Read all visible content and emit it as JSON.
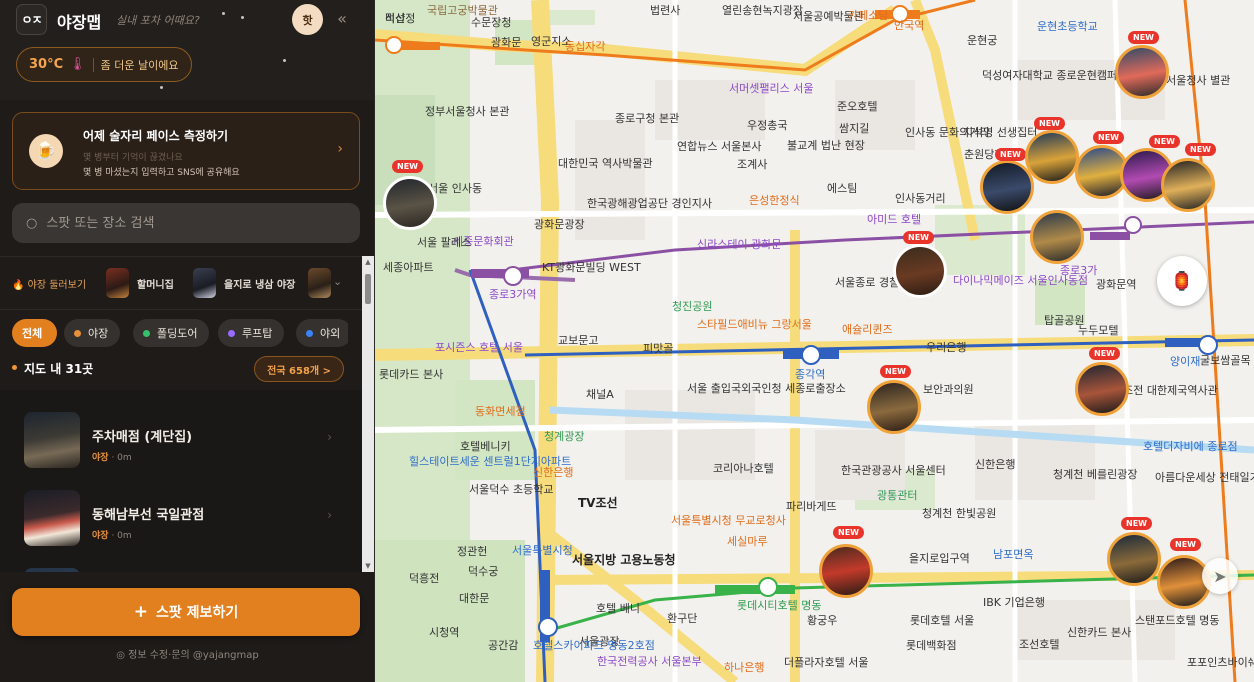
{
  "header": {
    "logo_text": "ㅇㅈ",
    "app_title": "야장맵",
    "tagline": "실내 포차 어때요?",
    "night_toggle_label": "핫"
  },
  "weather": {
    "temperature": "30°C",
    "message": "좀 더운 날이에요"
  },
  "promo": {
    "title": "어제 술자리 페이스 측정하기",
    "line1": "몇 병부터 기억이 끊겼나요",
    "line2": "몇 병 마셨는지 입력하고 SNS에 공유해요"
  },
  "search": {
    "placeholder": "스팟 또는 장소 검색"
  },
  "tour": {
    "label": "야장 둘러보기",
    "items": [
      {
        "label": "할머니집"
      },
      {
        "label": "을지로 냉삼 야장"
      }
    ]
  },
  "filters": [
    {
      "label": "전체",
      "color": "#e27f1e"
    },
    {
      "label": "야장",
      "color": "#e8913b"
    },
    {
      "label": "폴딩도어",
      "color": "#36c06b"
    },
    {
      "label": "루프탑",
      "color": "#9a6bff"
    },
    {
      "label": "야외",
      "color": "#3a82f6"
    }
  ],
  "results": {
    "count_label": "지도 내 31곳",
    "nation_button": "전국 658개 >"
  },
  "spots": [
    {
      "name": "주차매점 (계단집)",
      "category": "야장",
      "distance": "· 0m"
    },
    {
      "name": "동해남부선 국일관점",
      "category": "야장",
      "distance": "· 0m"
    }
  ],
  "report_button": {
    "icon": "+",
    "label": "스팟 제보하기"
  },
  "footer": {
    "text": "정보 수정·문의 @yajangmap"
  },
  "map": {
    "labels": [
      "국립고궁박물관",
      "수문장청",
      "광화문",
      "영군지소",
      "동십자각",
      "법련사",
      "열린송현녹지광장",
      "서울공예박물관",
      "카페소담",
      "안국역",
      "운현궁",
      "운현초등학교",
      "덕성여자대학교 종로운현캠퍼스",
      "정부서울청사 본관",
      "종로구청 본관",
      "서머셋팰리스 서울",
      "우정총국",
      "준오호텔",
      "쌈지길",
      "인사동 문화의거리",
      "지석영 선생집터",
      "대한민국 역사박물관",
      "연합뉴스 서울본사",
      "조계사",
      "불교계 법난 현장",
      "광화문광장",
      "한국광해광업공단 경인지사",
      "은성한정식",
      "에스팀",
      "인사동거리",
      "세종문화회관",
      "신라스테이 광화문",
      "아미드 호텔",
      "다이나믹메이즈 서울인사동점",
      "탑골공원",
      "누두모텔",
      "세종아파트",
      "KT광화문빌딩 WEST",
      "서울종로 경찰서",
      "청진공원",
      "스타필드애비뉴 그랑서울",
      "애슐리퀸즈",
      "우리은행",
      "포시즌스 호텔 서울",
      "교보문고",
      "피맛골",
      "서울 출입국외국인청 세종로출장소",
      "종각역",
      "보안과의원",
      "채널A",
      "롯데카드 본사",
      "동화면세점",
      "청계광장",
      "호텔더자비에 종로점",
      "호텔베니키",
      "신한은행",
      "코리아나호텔",
      "한국관광공사 서울센터",
      "신한은행",
      "청계천 베를린광장",
      "아름다운세상 전태일기념관",
      "힐스테이트세운 센트럴1단지아파트",
      "서울덕수 초등학교",
      "TV조선",
      "서울특별시청 무교로청사",
      "파리바게뜨",
      "광통관터",
      "청계천 한빛공원",
      "서울지방 고용노동청",
      "서울특별시청",
      "세실마루",
      "남포면옥",
      "롯데시티호텔 명동",
      "을지로입구역",
      "IBK 기업은행",
      "신한카드 본사",
      "조선호텔",
      "포포인츠바이쉐라톤 서울명동",
      "호텔 베니",
      "서울광장",
      "환구단",
      "황궁우",
      "롯데호텔 서울",
      "한국전력공사 서울본부",
      "하나은행",
      "더플라자호텔 서울",
      "롯데백화점",
      "스탠포드호텔 명동",
      "호텔스카이파크 명동2호점",
      "공간감",
      "시청역",
      "대한문",
      "덕수궁",
      "덕흥전",
      "정관헌",
      "석조전 대한제국역사관",
      "양이재",
      "굴보쌈골목",
      "종로3가역",
      "종로3가",
      "광화문역",
      "서울 인사동",
      "춘원당한의원",
      "부서울청사 별관",
      "서울 팔레스",
      "비샵",
      "적선정"
    ]
  },
  "colors": {
    "accent": "#e27f1e",
    "new_badge": "#e8342b",
    "sidebar_bg": "#1e1b19"
  }
}
